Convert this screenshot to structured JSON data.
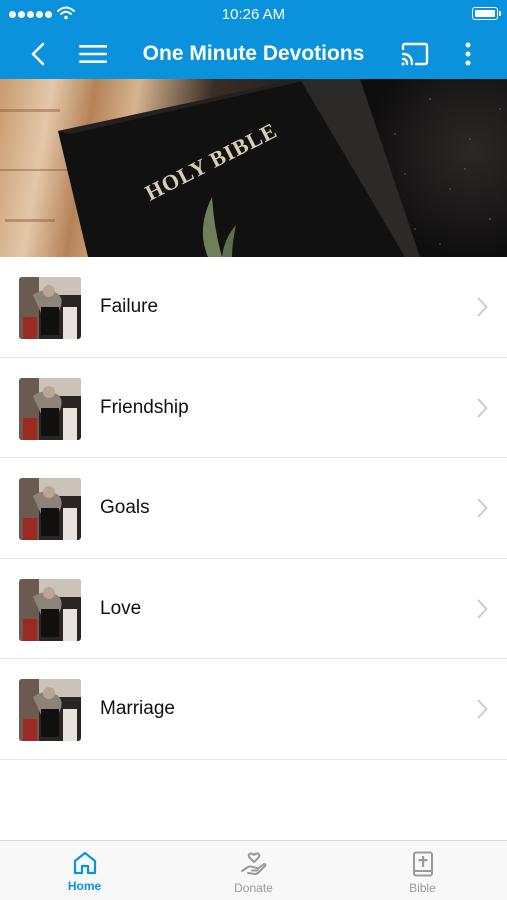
{
  "status_bar": {
    "time": "10:26 AM"
  },
  "header": {
    "title": "One Minute Devotions",
    "back_icon": "chevron-left-icon",
    "menu_icon": "hamburger-icon",
    "cast_icon": "cast-icon",
    "more_icon": "more-vertical-icon"
  },
  "hero": {
    "image": "holy-bible-photo",
    "book_text": "HOLY BIBLE"
  },
  "devotions": {
    "items": [
      {
        "label": "Failure"
      },
      {
        "label": "Friendship"
      },
      {
        "label": "Goals"
      },
      {
        "label": "Love"
      },
      {
        "label": "Marriage"
      }
    ]
  },
  "tabbar": {
    "tabs": [
      {
        "label": "Home",
        "icon": "home-icon",
        "active": true
      },
      {
        "label": "Donate",
        "icon": "donate-icon",
        "active": false
      },
      {
        "label": "Bible",
        "icon": "bible-icon",
        "active": false
      }
    ]
  },
  "colors": {
    "accent": "#0a93dc",
    "inactive": "#9a9a9a",
    "divider": "#e6e6e6"
  }
}
